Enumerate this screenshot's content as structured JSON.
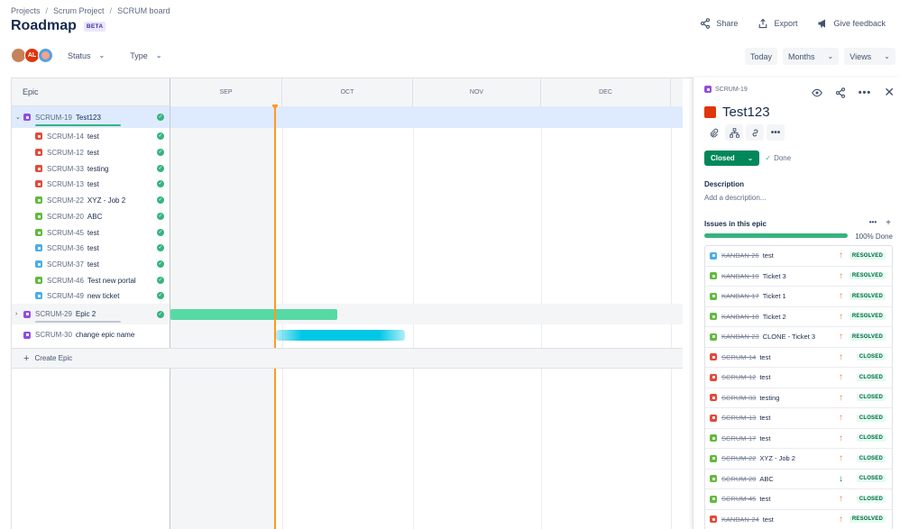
{
  "breadcrumb": [
    "Projects",
    "Scrum Project",
    "SCRUM board"
  ],
  "page": {
    "title": "Roadmap",
    "badge": "BETA"
  },
  "header_actions": {
    "share": "Share",
    "export": "Export",
    "feedback": "Give feedback"
  },
  "avatars": [
    {
      "initials": ""
    },
    {
      "initials": "AL"
    },
    {
      "initials": ""
    }
  ],
  "filters": {
    "status": "Status",
    "type": "Type"
  },
  "controls": {
    "today": "Today",
    "months": "Months",
    "views": "Views"
  },
  "grid": {
    "epic_header": "Epic",
    "months": [
      "SEP",
      "OCT",
      "NOV",
      "DEC"
    ],
    "create_epic": "Create Epic"
  },
  "rows": [
    {
      "type": "epic",
      "key": "SCRUM-19",
      "summary": "Test123",
      "done": true
    },
    {
      "type": "bug",
      "key": "SCRUM-14",
      "summary": "test",
      "done": true
    },
    {
      "type": "bug",
      "key": "SCRUM-12",
      "summary": "test",
      "done": true
    },
    {
      "type": "bug",
      "key": "SCRUM-33",
      "summary": "testing",
      "done": true
    },
    {
      "type": "bug",
      "key": "SCRUM-13",
      "summary": "test",
      "done": true
    },
    {
      "type": "story",
      "key": "SCRUM-22",
      "summary": "XYZ - Job 2",
      "done": true
    },
    {
      "type": "story",
      "key": "SCRUM-20",
      "summary": "ABC",
      "done": true
    },
    {
      "type": "story",
      "key": "SCRUM-45",
      "summary": "test",
      "done": true
    },
    {
      "type": "task",
      "key": "SCRUM-36",
      "summary": "test",
      "done": true
    },
    {
      "type": "task",
      "key": "SCRUM-37",
      "summary": "test",
      "done": true
    },
    {
      "type": "story",
      "key": "SCRUM-46",
      "summary": "Test new portal",
      "done": true
    },
    {
      "type": "task",
      "key": "SCRUM-49",
      "summary": "new ticket",
      "done": true
    },
    {
      "type": "epic",
      "key": "SCRUM-29",
      "summary": "Epic 2",
      "done": true
    },
    {
      "type": "epic",
      "key": "SCRUM-30",
      "summary": "change epic name",
      "done": false
    }
  ],
  "colors": {
    "epic_bar_1": "#57d9a3",
    "epic_bar_2": "#00c7e6",
    "today_line": "#ff991f",
    "status_green": "#00875a"
  },
  "panel": {
    "key": "SCRUM-19",
    "title": "Test123",
    "status_button": "Closed",
    "status_done": "Done",
    "description_label": "Description",
    "description_placeholder": "Add a description...",
    "issues_label": "Issues in this epic",
    "progress_percent": 100,
    "progress_text": "100% Done",
    "issues": [
      {
        "type": "task",
        "key": "KANBAN-26",
        "summary": "test",
        "priority": "up",
        "status": "RESOLVED"
      },
      {
        "type": "story",
        "key": "KANBAN-19",
        "summary": "Ticket 3",
        "priority": "up",
        "status": "RESOLVED"
      },
      {
        "type": "story",
        "key": "KANBAN-17",
        "summary": "Ticket 1",
        "priority": "up",
        "status": "RESOLVED"
      },
      {
        "type": "story",
        "key": "KANBAN-18",
        "summary": "Ticket 2",
        "priority": "up",
        "status": "RESOLVED"
      },
      {
        "type": "story",
        "key": "KANBAN-23",
        "summary": "CLONE - Ticket 3",
        "priority": "up",
        "status": "RESOLVED"
      },
      {
        "type": "bug",
        "key": "SCRUM-14",
        "summary": "test",
        "priority": "up",
        "status": "CLOSED"
      },
      {
        "type": "bug",
        "key": "SCRUM-12",
        "summary": "test",
        "priority": "up",
        "status": "CLOSED"
      },
      {
        "type": "bug",
        "key": "SCRUM-33",
        "summary": "testing",
        "priority": "up",
        "status": "CLOSED"
      },
      {
        "type": "bug",
        "key": "SCRUM-13",
        "summary": "test",
        "priority": "up",
        "status": "CLOSED"
      },
      {
        "type": "story",
        "key": "SCRUM-17",
        "summary": "test",
        "priority": "up",
        "status": "CLOSED"
      },
      {
        "type": "story",
        "key": "SCRUM-22",
        "summary": "XYZ - Job 2",
        "priority": "up",
        "status": "CLOSED"
      },
      {
        "type": "story",
        "key": "SCRUM-20",
        "summary": "ABC",
        "priority": "down",
        "status": "CLOSED"
      },
      {
        "type": "story",
        "key": "SCRUM-45",
        "summary": "test",
        "priority": "up",
        "status": "CLOSED"
      },
      {
        "type": "bug",
        "key": "KANBAN-24",
        "summary": "test",
        "priority": "up",
        "status": "RESOLVED"
      }
    ]
  }
}
